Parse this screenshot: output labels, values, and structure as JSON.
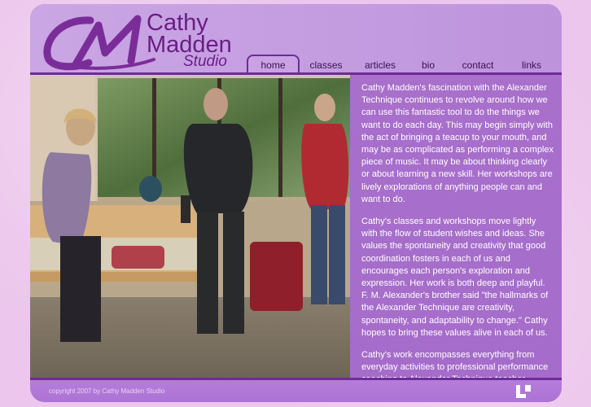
{
  "logo": {
    "line1": "Cathy",
    "line2": "Madden",
    "line3": "Studio"
  },
  "nav": [
    {
      "label": "home",
      "active": true
    },
    {
      "label": "classes",
      "active": false
    },
    {
      "label": "articles",
      "active": false
    },
    {
      "label": "bio",
      "active": false
    },
    {
      "label": "contact",
      "active": false
    },
    {
      "label": "links",
      "active": false
    }
  ],
  "content": {
    "paragraphs": [
      "Cathy Madden's fascination with the Alexander Technique continues to revolve around how we can use this fantastic tool to do the things we want to do each day. This may begin simply with the act of bringing a teacup to your mouth, and may be as complicated as performing a complex piece of music.  It may be about thinking clearly or about learning a new skill. Her workshops are lively explorations of anything people can and want to do.",
      "Cathy's classes and workshops move lightly with the flow of student wishes and ideas. She values the spontaneity and creativity that good coordination fosters in each of us and encourages each person's exploration and expression. Her work is both deep and playful. F. M. Alexander's brother said \"the hallmarks of the Alexander Technique are creativity, spontaneity, and adaptability to change.\" Cathy hopes to bring these values alive in each of us.",
      "Cathy's work encompasses everything from everyday activities to professional performance coaching to Alexander Technique teacher training and continuing education."
    ]
  },
  "footer": {
    "copyright": "copyright 2007 by Cathy Madden Studio"
  },
  "colors": {
    "accent": "#6d2c96",
    "panel": "#a56ccb",
    "page_bg": "#ecc6ec"
  }
}
